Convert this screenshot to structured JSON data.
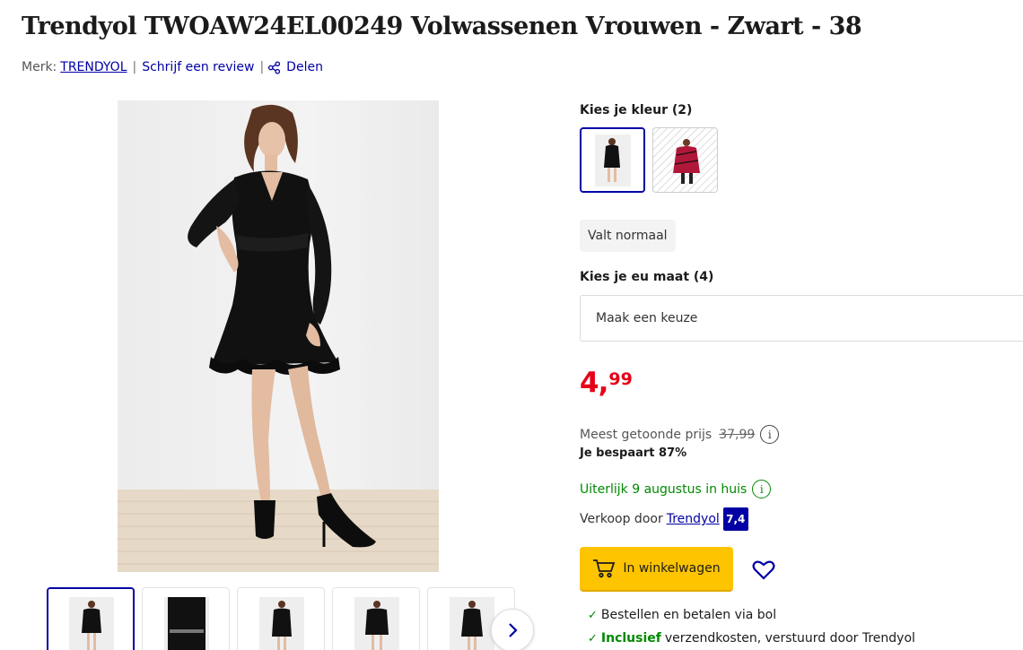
{
  "product": {
    "title": "Trendyol TWOAW24EL00249 Volwassenen Vrouwen - Zwart - 38"
  },
  "meta": {
    "brand_prefix": "Merk:",
    "brand": "TRENDYOL",
    "separator": "|",
    "review_link": "Schrijf een review",
    "separator2": "|",
    "share_link": "Delen"
  },
  "gallery": {
    "thumbnail_count": 5,
    "next_icon": "chevron-right-icon"
  },
  "color": {
    "label": "Kies je kleur (2)",
    "options": [
      {
        "name": "Zwart",
        "selected": true,
        "swatch": "#111111"
      },
      {
        "name": "Rood",
        "selected": false,
        "swatch": "#b0183a"
      }
    ]
  },
  "fit": {
    "label": "Valt normaal"
  },
  "size": {
    "label": "Kies je eu maat (4)",
    "placeholder": "Maak een keuze"
  },
  "price": {
    "whole": "4",
    "cents": "99",
    "color": "#e60018"
  },
  "list_price": {
    "label": "Meest getoonde prijs",
    "value": "37,99",
    "info_icon": "i"
  },
  "saving": "Je bespaart 87%",
  "delivery": {
    "text": "Uiterlijk 9 augustus in huis",
    "info_icon": "i",
    "color": "#008a00"
  },
  "seller": {
    "prefix": "Verkoop door",
    "name": "Trendyol",
    "score": "7,4"
  },
  "actions": {
    "cart_label": "In winkelwagen",
    "cart_color": "#ffc400",
    "wishlist_icon": "heart-icon"
  },
  "usps": [
    {
      "bold": "",
      "text": "Bestellen en betalen via bol"
    },
    {
      "bold": "Inclusief",
      "text": "verzendkosten, verstuurd door Trendyol"
    }
  ]
}
